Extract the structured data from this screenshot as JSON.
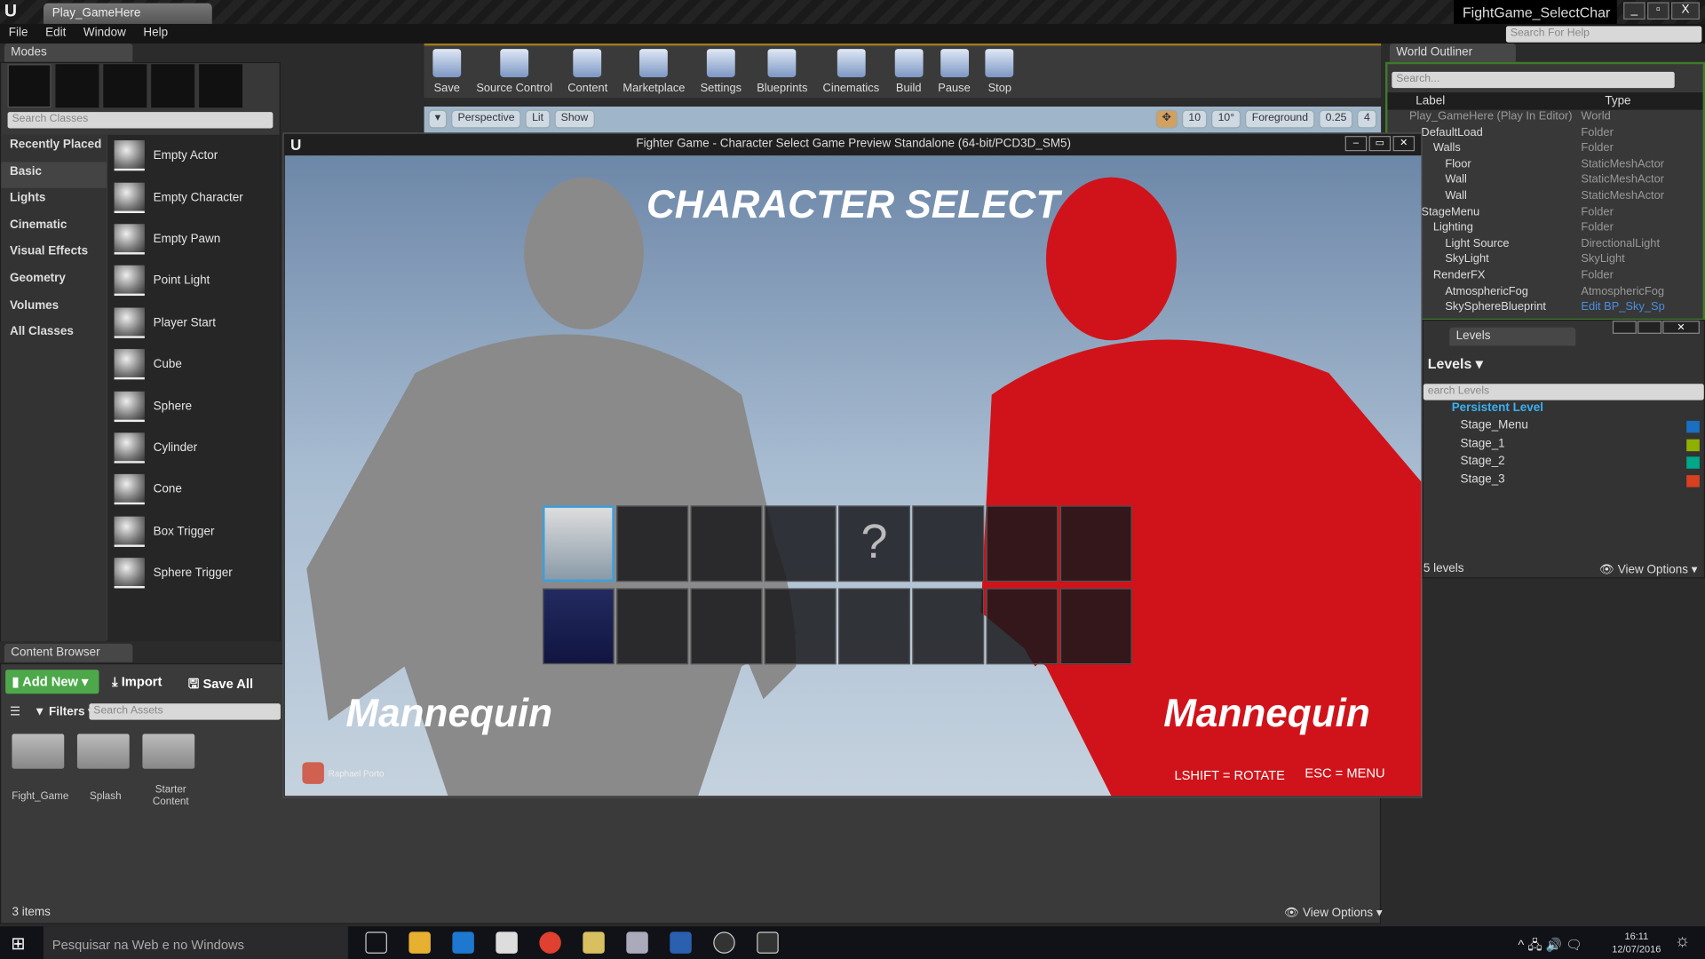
{
  "window": {
    "tab": "Play_GameHere",
    "project": "FightGame_SelectChar",
    "help_placeholder": "Search For Help"
  },
  "menu": [
    "File",
    "Edit",
    "Window",
    "Help"
  ],
  "modes": {
    "tab": "Modes",
    "search_placeholder": "Search Classes",
    "categories": [
      "Recently Placed",
      "Basic",
      "Lights",
      "Cinematic",
      "Visual Effects",
      "Geometry",
      "Volumes",
      "All Classes"
    ],
    "items": [
      "Empty Actor",
      "Empty Character",
      "Empty Pawn",
      "Point Light",
      "Player Start",
      "Cube",
      "Sphere",
      "Cylinder",
      "Cone",
      "Box Trigger",
      "Sphere Trigger"
    ]
  },
  "toolbar": [
    "Save",
    "Source Control",
    "Content",
    "Marketplace",
    "Settings",
    "Blueprints",
    "Cinematics",
    "Build",
    "Pause",
    "Stop"
  ],
  "viewport": {
    "perspective": "Perspective",
    "lit": "Lit",
    "show": "Show",
    "grid": "10",
    "angle": "10°",
    "layer": "Foreground",
    "scale": "0.25",
    "camera": "4"
  },
  "game": {
    "title": "Fighter Game - Character Select  Game Preview Standalone (64-bit/PCD3D_SM5)",
    "heading": "CHARACTER SELECT",
    "left_name": "Mannequin",
    "right_name": "Mannequin",
    "unknown": "?",
    "rotate_hint": "LSHIFT = ROTATE",
    "menu_hint": "ESC = MENU",
    "credit": "Raphael Porto",
    "colors": {
      "left": "#8a8a8a",
      "right": "#d0131a",
      "selected": "#3aa0e0"
    }
  },
  "outliner": {
    "tab": "World Outliner",
    "search_placeholder": "Search...",
    "col_label": "Label",
    "col_type": "Type",
    "rows": [
      {
        "label": "Play_GameHere (Play In Editor)",
        "type": "World",
        "d": 0
      },
      {
        "label": "DefaultLoad",
        "type": "Folder",
        "d": 1
      },
      {
        "label": "Walls",
        "type": "Folder",
        "d": 2
      },
      {
        "label": "Floor",
        "type": "StaticMeshActor",
        "d": 3
      },
      {
        "label": "Wall",
        "type": "StaticMeshActor",
        "d": 3
      },
      {
        "label": "Wall",
        "type": "StaticMeshActor",
        "d": 3
      },
      {
        "label": "StageMenu",
        "type": "Folder",
        "d": 1
      },
      {
        "label": "Lighting",
        "type": "Folder",
        "d": 2
      },
      {
        "label": "Light Source",
        "type": "DirectionalLight",
        "d": 3
      },
      {
        "label": "SkyLight",
        "type": "SkyLight",
        "d": 3
      },
      {
        "label": "RenderFX",
        "type": "Folder",
        "d": 2
      },
      {
        "label": "AtmosphericFog",
        "type": "AtmosphericFog",
        "d": 3
      },
      {
        "label": "SkySphereBlueprint",
        "type": "Edit BP_Sky_Sp",
        "d": 3
      }
    ]
  },
  "levels": {
    "tab": "Levels",
    "header": "Levels",
    "search_placeholder": "earch Levels",
    "count": "5 levels",
    "view_options": "View Options",
    "rows": [
      {
        "name": "Persistent Level",
        "color": ""
      },
      {
        "name": "Stage_Menu",
        "color": "#1a6fc0"
      },
      {
        "name": "Stage_1",
        "color": "#8fb000"
      },
      {
        "name": "Stage_2",
        "color": "#00a88a"
      },
      {
        "name": "Stage_3",
        "color": "#d84020"
      }
    ]
  },
  "content": {
    "tab": "Content Browser",
    "add_new": "Add New",
    "import": "Import",
    "save_all": "Save All",
    "filters": "Filters",
    "search_placeholder": "Search Assets",
    "folders": [
      "Fight_Game",
      "Splash",
      "Starter Content"
    ],
    "count": "3 items",
    "view_options": "View Options"
  },
  "taskbar": {
    "search": "Pesquisar na Web e no Windows",
    "time": "16:11",
    "date": "12/07/2016"
  }
}
